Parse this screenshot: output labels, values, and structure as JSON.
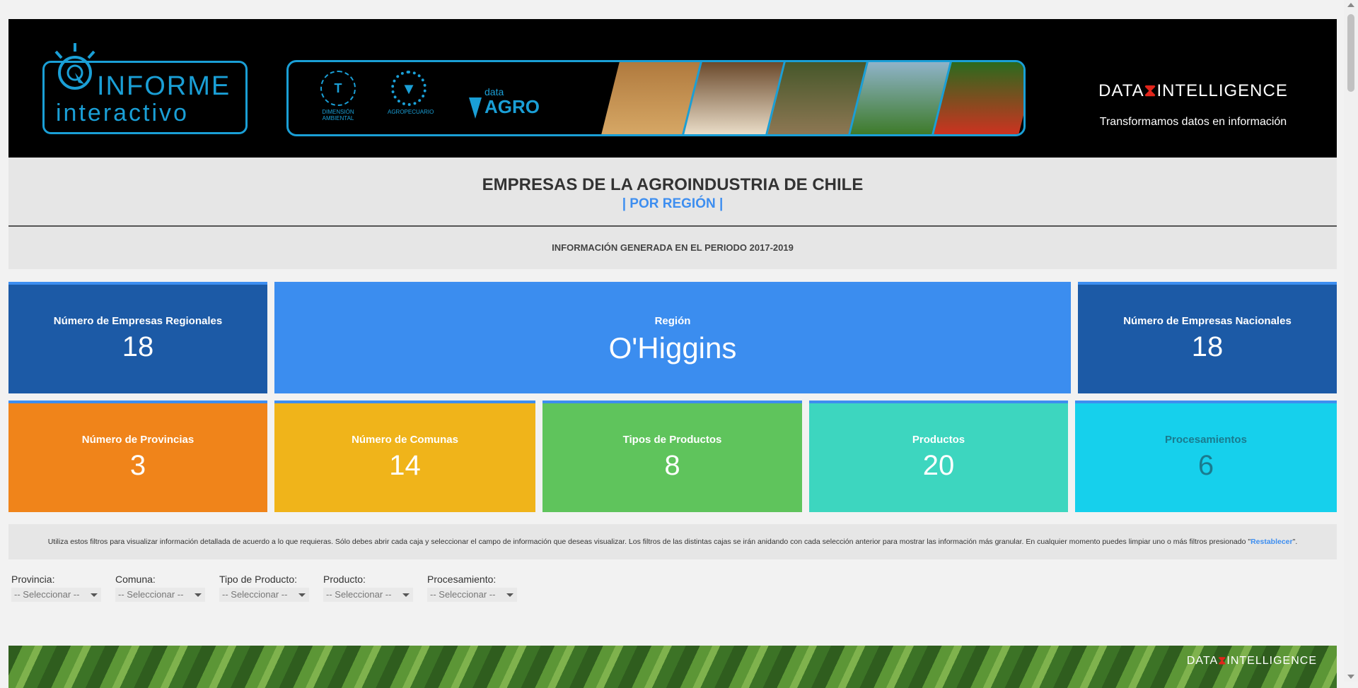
{
  "header": {
    "logo_line1": "INFORME",
    "logo_line2": "interactivo",
    "partner1_label": "DIMENSIÓN AMBIENTAL",
    "partner2_label": "AGROPECUARIO",
    "partner3_small": "data",
    "partner3_big": "AGRO",
    "brand_left": "DATA",
    "brand_right": "INTELLIGENCE",
    "brand_tagline": "Transformamos datos en información"
  },
  "title": {
    "main": "EMPRESAS DE LA AGROINDUSTRIA DE CHILE",
    "sub": "| POR REGIÓN |",
    "period": "INFORMACIÓN GENERADA EN EL PERIODO 2017-2019"
  },
  "kpis_top": [
    {
      "label": "Número de Empresas Regionales",
      "value": "18",
      "color": "#1c5aa6"
    },
    {
      "label": "Región",
      "value": "O'Higgins",
      "color": "#3b8def"
    },
    {
      "label": "Número de Empresas Nacionales",
      "value": "18",
      "color": "#1c5aa6"
    }
  ],
  "kpis_bottom": [
    {
      "label": "Número de Provincias",
      "value": "3",
      "color": "#f0841a"
    },
    {
      "label": "Número de Comunas",
      "value": "14",
      "color": "#f0b41a"
    },
    {
      "label": "Tipos de Productos",
      "value": "8",
      "color": "#5fc45c"
    },
    {
      "label": "Productos",
      "value": "20",
      "color": "#3dd6bf"
    },
    {
      "label": "Procesamientos",
      "value": "6",
      "color": "#16d0ec"
    }
  ],
  "info": {
    "text": "Utiliza estos filtros para visualizar información detallada de acuerdo a lo que requieras. Sólo debes abrir cada caja y seleccionar el campo de información que deseas visualizar. Los filtros de las distintas cajas se irán anidando con cada selección anterior para mostrar las información más granular. En cualquier momento puedes limpiar uno o más filtros presionado \"",
    "link": "Restablecer",
    "end": "\"."
  },
  "filters": [
    {
      "label": "Provincia:",
      "value": "-- Seleccionar --"
    },
    {
      "label": "Comuna:",
      "value": "-- Seleccionar --"
    },
    {
      "label": "Tipo de Producto:",
      "value": "-- Seleccionar --"
    },
    {
      "label": "Producto:",
      "value": "-- Seleccionar --"
    },
    {
      "label": "Procesamiento:",
      "value": "-- Seleccionar --"
    }
  ],
  "footer": {
    "brand_left": "DATA",
    "brand_right": "INTELLIGENCE"
  }
}
